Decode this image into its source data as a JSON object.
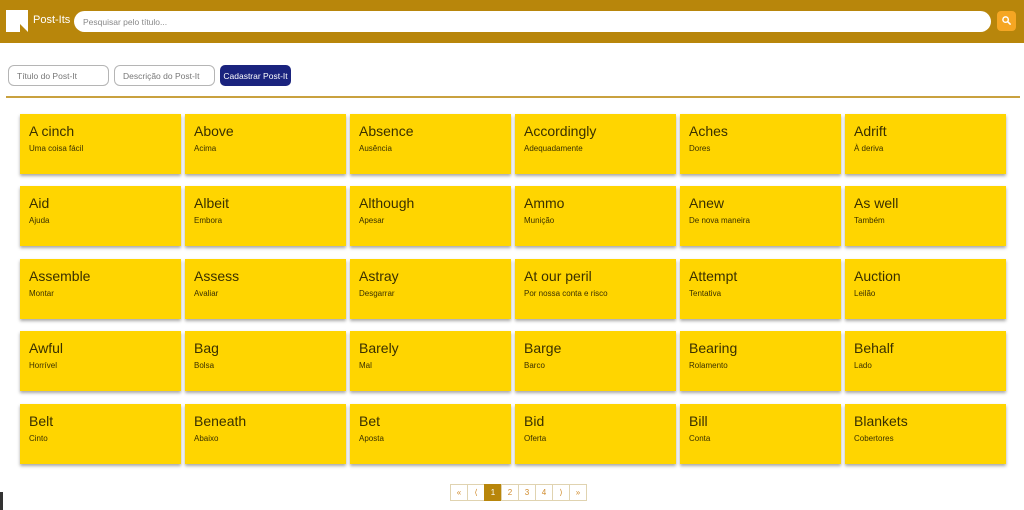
{
  "header": {
    "app_name": "Post-Its",
    "search_placeholder": "Pesquisar pelo título...",
    "accent_color": "#b8860b"
  },
  "form": {
    "title_placeholder": "Título do Post-It",
    "description_placeholder": "Descrição do Post-It",
    "submit_label": "Cadastrar Post-It"
  },
  "cards": [
    {
      "title": "A cinch",
      "description": "Uma coisa fácil"
    },
    {
      "title": "Above",
      "description": "Acima"
    },
    {
      "title": "Absence",
      "description": "Ausência"
    },
    {
      "title": "Accordingly",
      "description": "Adequadamente"
    },
    {
      "title": "Aches",
      "description": "Dores"
    },
    {
      "title": "Adrift",
      "description": "À deriva"
    },
    {
      "title": "Aid",
      "description": "Ajuda"
    },
    {
      "title": "Albeit",
      "description": "Embora"
    },
    {
      "title": "Although",
      "description": "Apesar"
    },
    {
      "title": "Ammo",
      "description": "Munição"
    },
    {
      "title": "Anew",
      "description": "De nova maneira"
    },
    {
      "title": "As well",
      "description": "Também"
    },
    {
      "title": "Assemble",
      "description": "Montar"
    },
    {
      "title": "Assess",
      "description": "Avaliar"
    },
    {
      "title": "Astray",
      "description": "Desgarrar"
    },
    {
      "title": "At our peril",
      "description": "Por nossa conta e risco"
    },
    {
      "title": "Attempt",
      "description": "Tentativa"
    },
    {
      "title": "Auction",
      "description": "Leilão"
    },
    {
      "title": "Awful",
      "description": "Horrível"
    },
    {
      "title": "Bag",
      "description": "Bolsa"
    },
    {
      "title": "Barely",
      "description": "Mal"
    },
    {
      "title": "Barge",
      "description": "Barco"
    },
    {
      "title": "Bearing",
      "description": "Rolamento"
    },
    {
      "title": "Behalf",
      "description": "Lado"
    },
    {
      "title": "Belt",
      "description": "Cinto"
    },
    {
      "title": "Beneath",
      "description": "Abaixo"
    },
    {
      "title": "Bet",
      "description": "Aposta"
    },
    {
      "title": "Bid",
      "description": "Oferta"
    },
    {
      "title": "Bill",
      "description": "Conta"
    },
    {
      "title": "Blankets",
      "description": "Cobertores"
    }
  ],
  "pagination": {
    "first": "«",
    "prev": "⟨",
    "pages": [
      "1",
      "2",
      "3",
      "4"
    ],
    "current": "1",
    "next": "⟩",
    "last": "»"
  }
}
